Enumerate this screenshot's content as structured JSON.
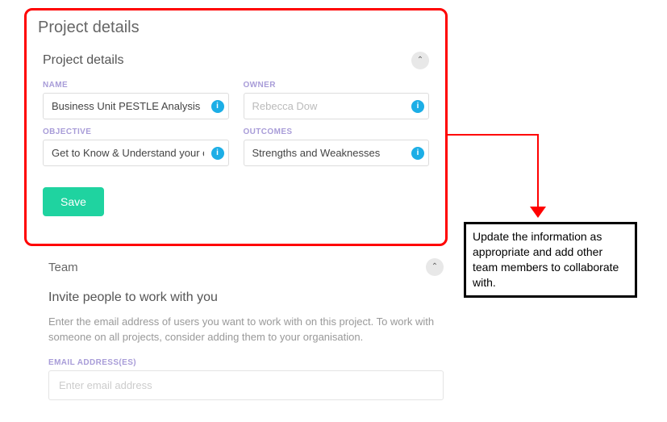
{
  "page_title": "Project details",
  "details_panel": {
    "title": "Project details",
    "fields": {
      "name": {
        "label": "NAME",
        "value": "Business Unit PESTLE Analysis"
      },
      "owner": {
        "label": "OWNER",
        "value": "Rebecca Dow"
      },
      "objective": {
        "label": "OBJECTIVE",
        "value": "Get to Know & Understand your own"
      },
      "outcomes": {
        "label": "OUTCOMES",
        "value": "Strengths and Weaknesses"
      }
    },
    "save_label": "Save"
  },
  "team_section": {
    "title": "Team",
    "subtitle": "Invite people to work with you",
    "description": "Enter the email address of users you want to work with on this project. To work with someone on all projects, consider adding them to your organisation.",
    "email_label": "EMAIL ADDRESS(ES)",
    "email_placeholder": "Enter email address"
  },
  "callout": "Update the information as appropriate and add other team members to collaborate with.",
  "icons": {
    "info_glyph": "i",
    "chevron_up": "⌃"
  }
}
